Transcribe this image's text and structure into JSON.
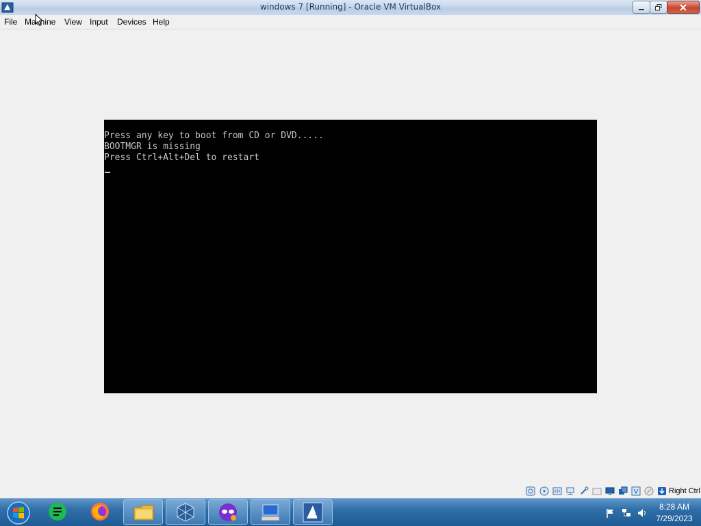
{
  "window": {
    "title": "windows 7 [Running] - Oracle VM VirtualBox"
  },
  "menu": {
    "items": [
      {
        "label": "File"
      },
      {
        "label": "Machine"
      },
      {
        "label": "View"
      },
      {
        "label": "Input"
      },
      {
        "label": "Devices"
      },
      {
        "label": "Help"
      }
    ]
  },
  "console": {
    "lines": [
      "Press any key to boot from CD or DVD.....",
      "BOOTMGR is missing",
      "Press Ctrl+Alt+Del to restart"
    ]
  },
  "statusbar": {
    "icons": [
      "hard-disk-icon",
      "optical-drive-icon",
      "audio-icon",
      "network-icon",
      "usb-icon",
      "shared-folders-icon",
      "display-icon",
      "video-capture-icon",
      "cpu-icon",
      "mouse-integration-icon",
      "keyboard-capture-icon"
    ],
    "host_key": "Right Ctrl"
  },
  "taskbar": {
    "apps": [
      "start-orb",
      "google-sheets-icon",
      "firefox-icon",
      "file-explorer-icon",
      "virtualbox-icon",
      "app-mask-icon",
      "remote-desktop-icon",
      "windows7-vm-icon"
    ],
    "time": "8:28 AM",
    "date": "7/29/2023"
  },
  "colors": {
    "console_text": "#c8c8c8",
    "console_bg": "#000000",
    "taskbar": "#2f6ea8"
  }
}
